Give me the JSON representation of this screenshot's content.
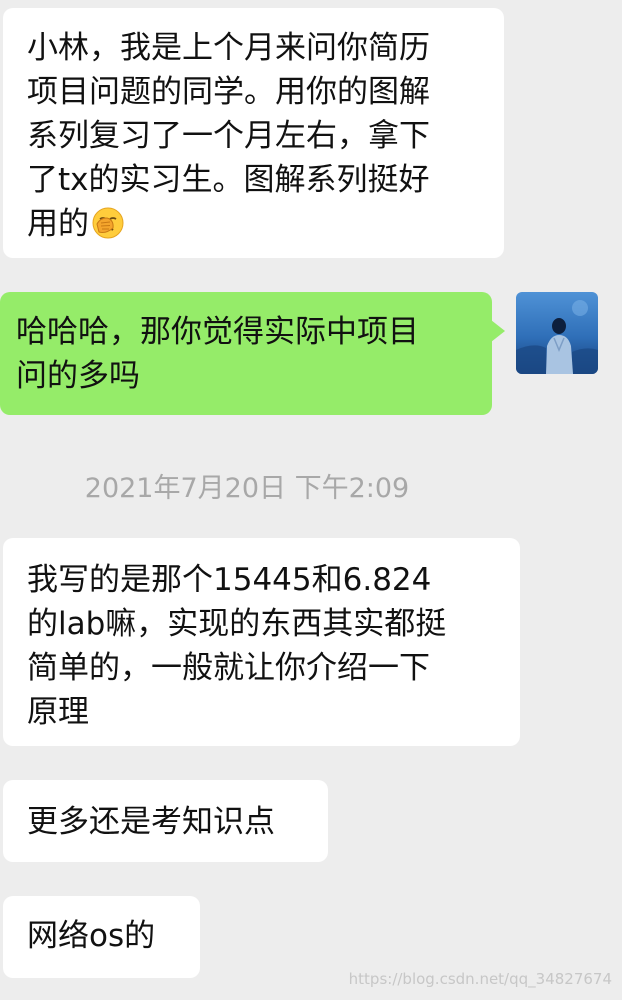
{
  "messages": [
    {
      "sender": "other",
      "text": "小林，我是上个月来问你简历\n项目问题的同学。用你的图解\n系列复习了一个月左右，拿下\n了tx的实习生。图解系列挺好\n用的",
      "emoji": "face-palm-emoji"
    },
    {
      "sender": "self",
      "text": "哈哈哈，那你觉得实际中项目\n问的多吗"
    },
    {
      "sender": "other",
      "text": "我写的是那个15445和6.824\n的lab嘛，实现的东西其实都挺\n简单的，一般就让你介绍一下\n原理"
    },
    {
      "sender": "other",
      "text": "更多还是考知识点"
    },
    {
      "sender": "other",
      "text": "网络os的"
    }
  ],
  "timestamp": "2021年7月20日 下午2:09",
  "watermark": "https://blog.csdn.net/qq_34827674",
  "colors": {
    "background": "#ededed",
    "self_bubble": "#95ec69",
    "other_bubble": "#ffffff",
    "timestamp": "#a8a8a8"
  },
  "avatar": {
    "icon": "person-silhouette-avatar",
    "tone": "blue"
  }
}
